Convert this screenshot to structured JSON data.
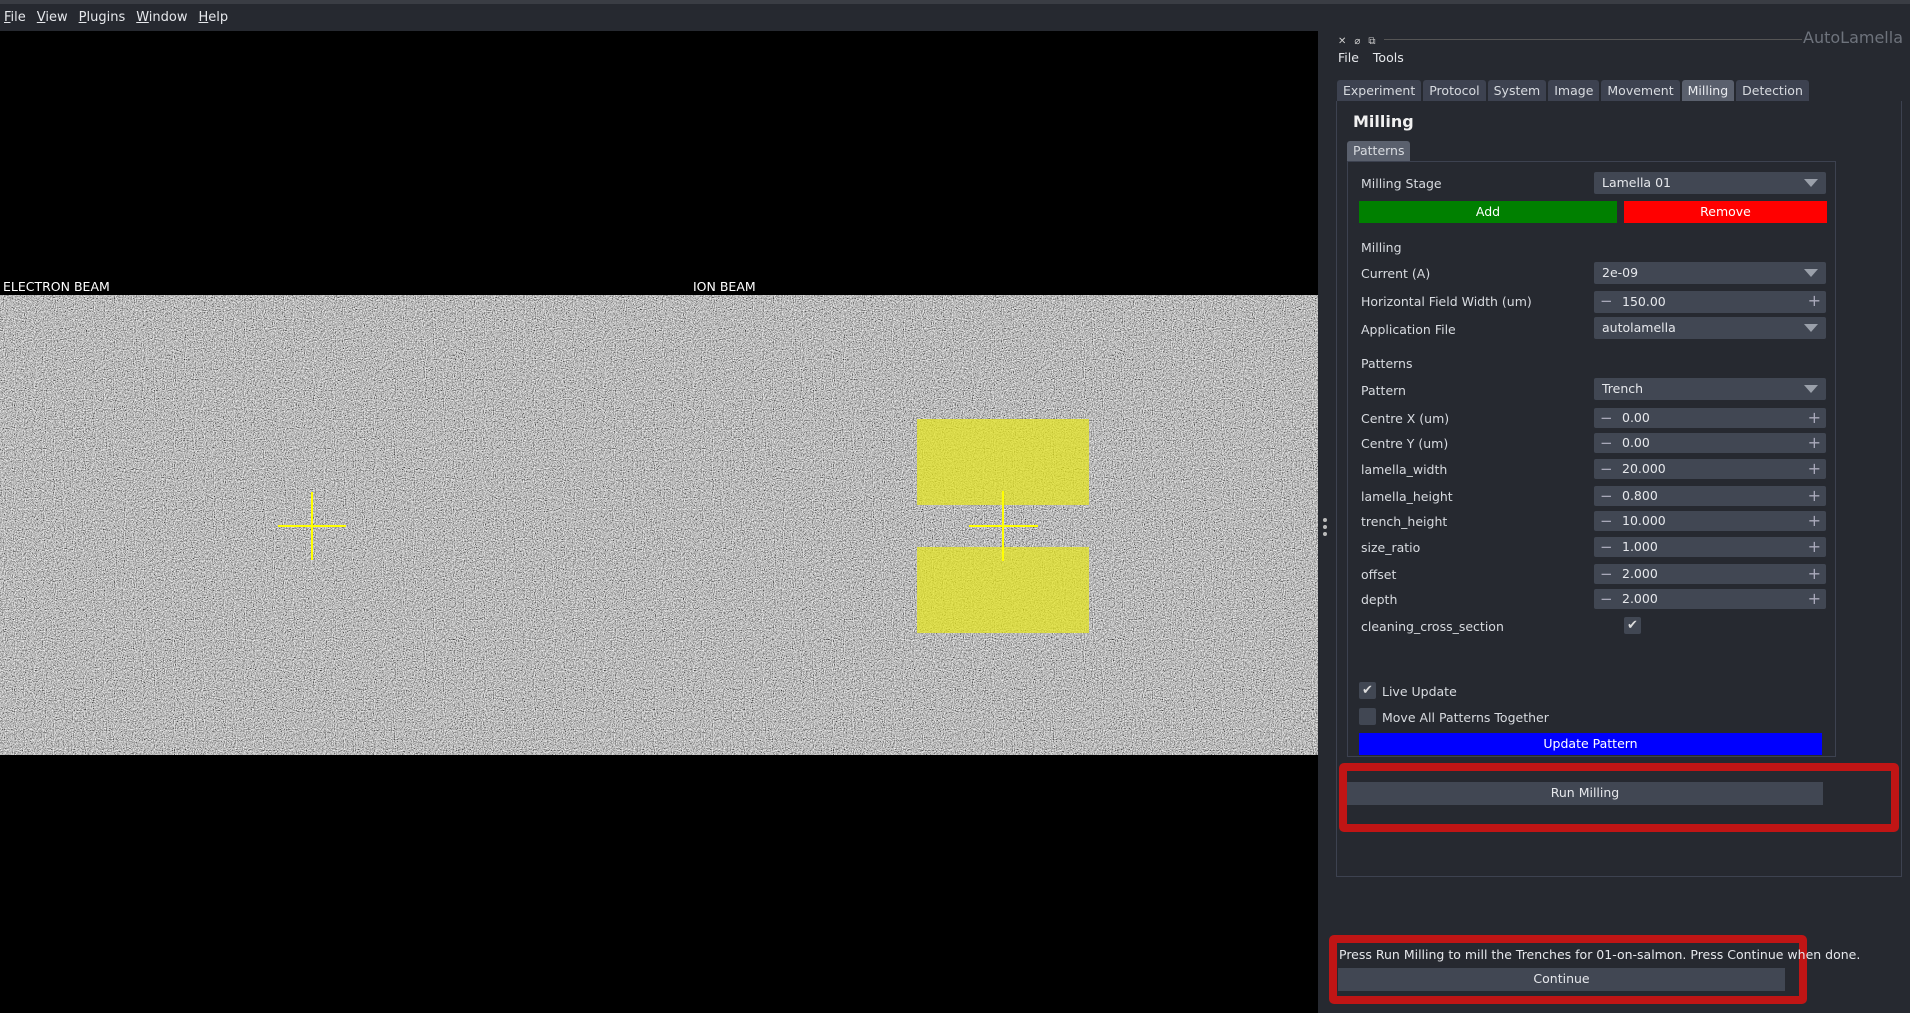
{
  "menubar": {
    "items": [
      "File",
      "View",
      "Plugins",
      "Window",
      "Help"
    ]
  },
  "viewer": {
    "electron_label": "ELECTRON BEAM",
    "ion_label": "ION BEAM",
    "pattern_color": "#e6e61e",
    "crosshair_color": "#ffff00"
  },
  "dock": {
    "title": "AutoLamella",
    "icons": [
      "close-icon",
      "float-icon",
      "restore-icon"
    ],
    "menu": [
      "File",
      "Tools"
    ]
  },
  "tabs": [
    "Experiment",
    "Protocol",
    "System",
    "Image",
    "Movement",
    "Milling",
    "Detection"
  ],
  "active_tab": "Milling",
  "milling": {
    "heading": "Milling",
    "subtab": "Patterns",
    "stage_label": "Milling Stage",
    "stage_value": "Lamella 01",
    "add": "Add",
    "remove": "Remove",
    "add_color": "#008000",
    "remove_color": "#ff0000",
    "section_milling": "Milling",
    "current_label": "Current (A)",
    "current_value": "2e-09",
    "hfw_label": "Horizontal Field Width (um)",
    "hfw_value": "150.00",
    "app_label": "Application File",
    "app_value": "autolamella",
    "section_patterns": "Patterns",
    "pattern_label": "Pattern",
    "pattern_value": "Trench",
    "params": [
      {
        "label": "Centre X (um)",
        "value": "0.00"
      },
      {
        "label": "Centre Y (um)",
        "value": "0.00"
      },
      {
        "label": "lamella_width",
        "value": "20.000"
      },
      {
        "label": "lamella_height",
        "value": "0.800"
      },
      {
        "label": "trench_height",
        "value": "10.000"
      },
      {
        "label": "size_ratio",
        "value": "1.000"
      },
      {
        "label": "offset",
        "value": "2.000"
      },
      {
        "label": "depth",
        "value": "2.000"
      }
    ],
    "ccs_label": "cleaning_cross_section",
    "ccs_checked": true,
    "live_update": "Live Update",
    "live_checked": true,
    "move_all": "Move All Patterns Together",
    "move_checked": false,
    "update_pattern": "Update Pattern",
    "update_color": "#0000ff",
    "run_milling": "Run Milling"
  },
  "footer": {
    "message": "Press Run Milling to mill the Trenches for 01-on-salmon. Press Continue when done.",
    "continue": "Continue"
  },
  "highlight_color": "#c01515"
}
